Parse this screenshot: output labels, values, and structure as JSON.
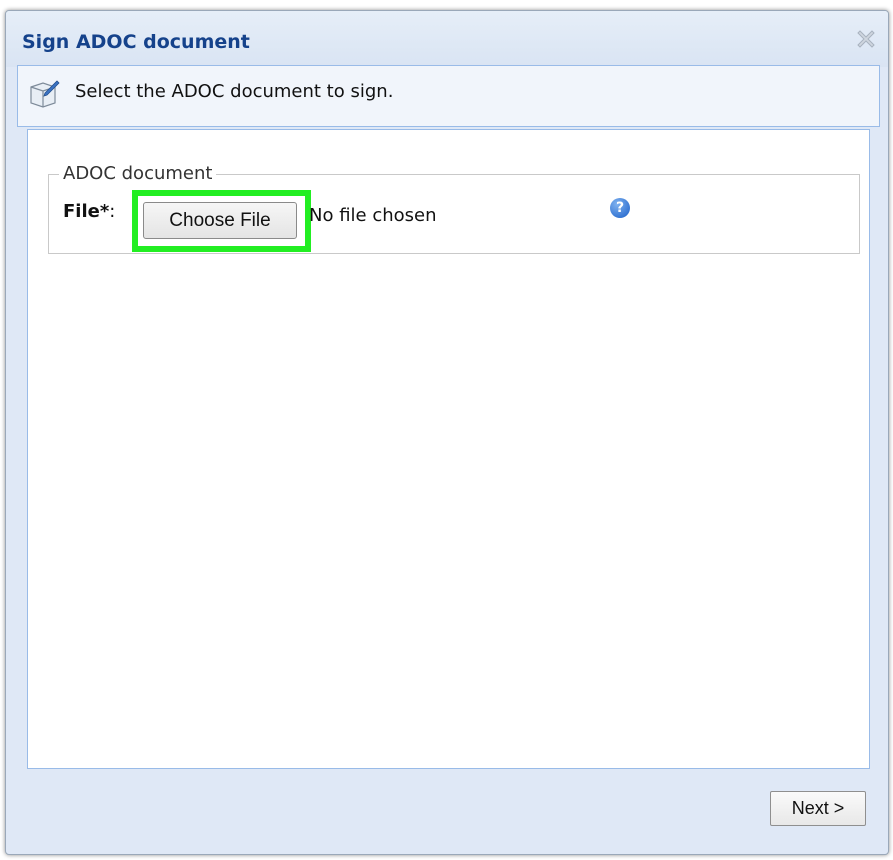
{
  "window": {
    "title": "Sign ADOC document",
    "close_icon": "close-icon"
  },
  "header": {
    "icon": "sign-document-icon",
    "instruction": "Select the ADOC document to sign."
  },
  "form": {
    "fieldset_legend": "ADOC document",
    "file_label": "File*",
    "file_label_colon": ":",
    "choose_button_label": "Choose File",
    "file_status": "No file chosen",
    "help_icon": "help-icon",
    "help_glyph": "?",
    "highlight_color": "#22ee22"
  },
  "footer": {
    "next_label": "Next >"
  },
  "colors": {
    "title": "#15428b",
    "window_bg": "#dfe8f6",
    "panel_border": "#99bbe8",
    "help_blue": "#1a5fc8"
  }
}
